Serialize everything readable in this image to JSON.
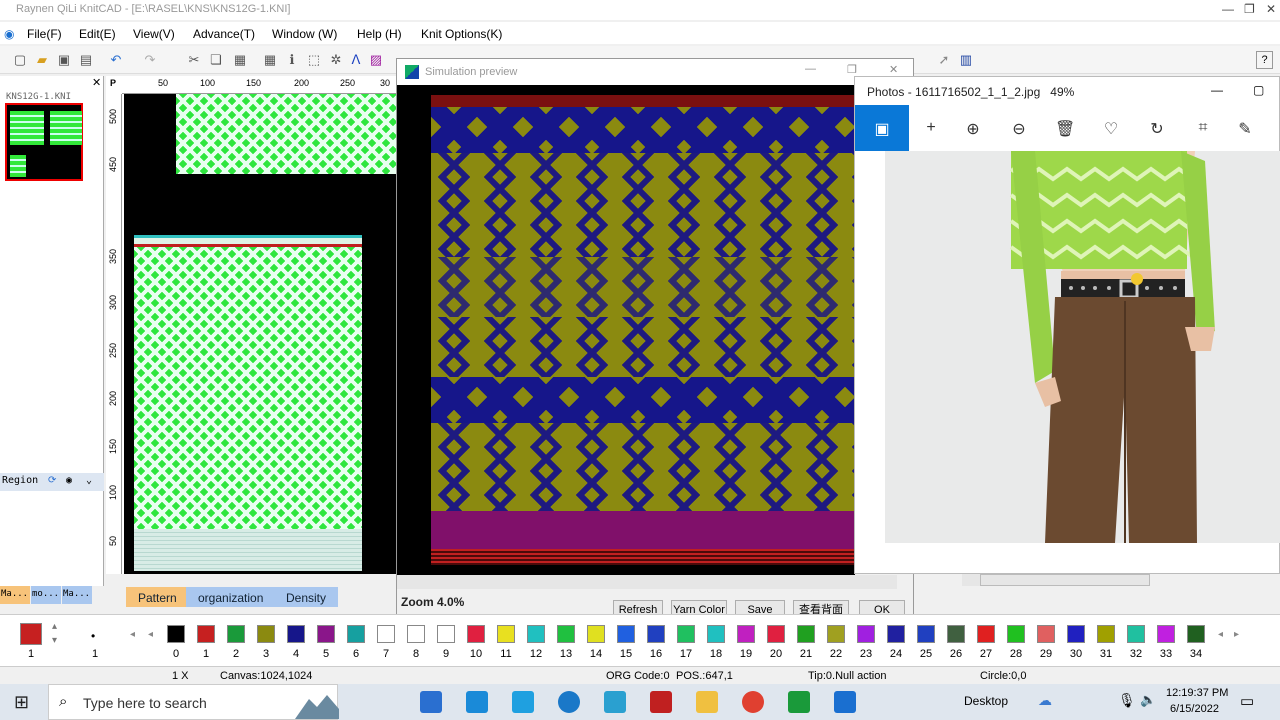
{
  "app": {
    "title": "Raynen QiLi KnitCAD - [E:\\RASEL\\KNS\\KNS12G-1.KNI]",
    "menu": [
      "File(F)",
      "Edit(E)",
      "View(V)",
      "Advance(T)",
      "Window (W)",
      "Help (H)",
      "Knit Options(K)"
    ],
    "help_btn": "?"
  },
  "left_panel": {
    "thumb_title": "KNS12G-1.KNI",
    "region_label": "Region",
    "tabs": [
      "Ma...",
      "mo...",
      "Ma..."
    ]
  },
  "canvas": {
    "ruler_x": [
      "P",
      "50",
      "100",
      "150",
      "200",
      "250",
      "30"
    ],
    "ruler_y": [
      "500",
      "450",
      "350",
      "300",
      "250",
      "200",
      "150",
      "100",
      "50"
    ],
    "tabs": [
      "Pattern",
      "organization",
      "Density"
    ]
  },
  "simulation": {
    "title": "Simulation preview",
    "zoom_label": "Zoom 4.0%",
    "buttons": [
      "Refresh",
      "Yarn Color",
      "Save",
      "查看背面",
      "OK"
    ]
  },
  "photos": {
    "title": "Photos - 1611716502_1_1_2.jpg",
    "zoom": "49%"
  },
  "colorbar": {
    "current": "1",
    "dot_num": "1",
    "swatches": [
      {
        "n": "0",
        "c": "#000000"
      },
      {
        "n": "1",
        "c": "#c62020"
      },
      {
        "n": "2",
        "c": "#1a9a3a"
      },
      {
        "n": "3",
        "c": "#8b8a10"
      },
      {
        "n": "4",
        "c": "#16168a"
      },
      {
        "n": "5",
        "c": "#8a168a"
      },
      {
        "n": "6",
        "c": "#16a0a0"
      },
      {
        "n": "7",
        "c": "#ffffff"
      },
      {
        "n": "8",
        "c": "#ffffff"
      },
      {
        "n": "9",
        "c": "#ffffff"
      },
      {
        "n": "10",
        "c": "#e02040"
      },
      {
        "n": "11",
        "c": "#e8e020"
      },
      {
        "n": "12",
        "c": "#20c0c0"
      },
      {
        "n": "13",
        "c": "#20c040"
      },
      {
        "n": "14",
        "c": "#e0e020"
      },
      {
        "n": "15",
        "c": "#2060e0"
      },
      {
        "n": "16",
        "c": "#2040c0"
      },
      {
        "n": "17",
        "c": "#20c060"
      },
      {
        "n": "18",
        "c": "#20c0c0"
      },
      {
        "n": "19",
        "c": "#c020c0"
      },
      {
        "n": "20",
        "c": "#e02040"
      },
      {
        "n": "21",
        "c": "#20a020"
      },
      {
        "n": "22",
        "c": "#a0a020"
      },
      {
        "n": "23",
        "c": "#a020e0"
      },
      {
        "n": "24",
        "c": "#2020a0"
      },
      {
        "n": "25",
        "c": "#2040c0"
      },
      {
        "n": "26",
        "c": "#406040"
      },
      {
        "n": "27",
        "c": "#e02020"
      },
      {
        "n": "28",
        "c": "#20c020"
      },
      {
        "n": "29",
        "c": "#e06060"
      },
      {
        "n": "30",
        "c": "#2020c0"
      },
      {
        "n": "31",
        "c": "#a0a000"
      },
      {
        "n": "32",
        "c": "#20c0a0"
      },
      {
        "n": "33",
        "c": "#c020e0"
      },
      {
        "n": "34",
        "c": "#206020"
      }
    ]
  },
  "status": {
    "zoom": "1 X",
    "canvas": "Canvas:1024,1024",
    "org": "ORG Code:0",
    "pos": "POS.:647,1",
    "tip": "Tip:0.Null action",
    "circle": "Circle:0,0"
  },
  "taskbar": {
    "search_placeholder": "Type here to search",
    "desktop": "Desktop",
    "time": "12:19:37 PM",
    "date": "6/15/2022"
  }
}
